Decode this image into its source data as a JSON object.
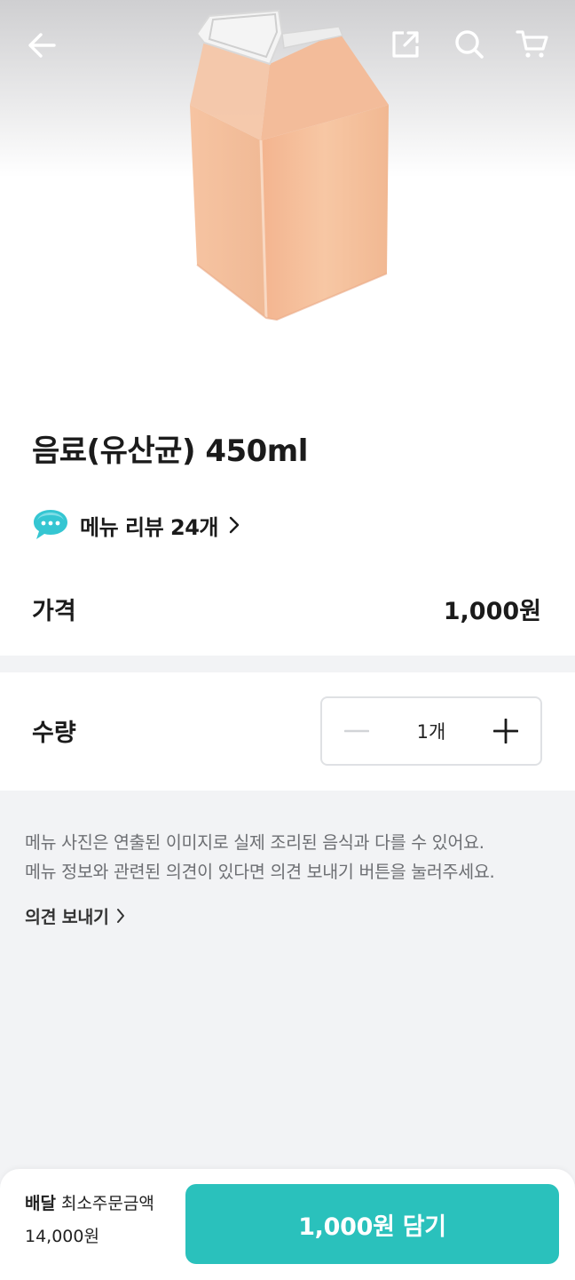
{
  "colors": {
    "accent": "#2ac1bc",
    "background": "#f2f3f5",
    "text": "#1b1b1b",
    "muted_text": "#6d6f73"
  },
  "header": {
    "back_icon": "arrow-left-icon",
    "share_icon": "share-icon",
    "search_icon": "search-icon",
    "cart_icon": "cart-icon"
  },
  "product": {
    "image": "milk-carton-drink-image",
    "title": "음료(유산균) 450ml",
    "review_label": "메뉴 리뷰 24개",
    "price_label": "가격",
    "price_value": "1,000원"
  },
  "quantity": {
    "label": "수량",
    "value": "1개"
  },
  "notice": {
    "line1": "메뉴 사진은 연출된 이미지로 실제 조리된 음식과 다를 수 있어요.",
    "line2": "메뉴 정보와 관련된 의견이 있다면 의견 보내기 버튼을 눌러주세요.",
    "feedback_label": "의견 보내기"
  },
  "bottom_bar": {
    "delivery_label": "배달",
    "min_order_label": "최소주문금액",
    "min_order_value": "14,000원",
    "add_button_label": "1,000원 담기"
  }
}
